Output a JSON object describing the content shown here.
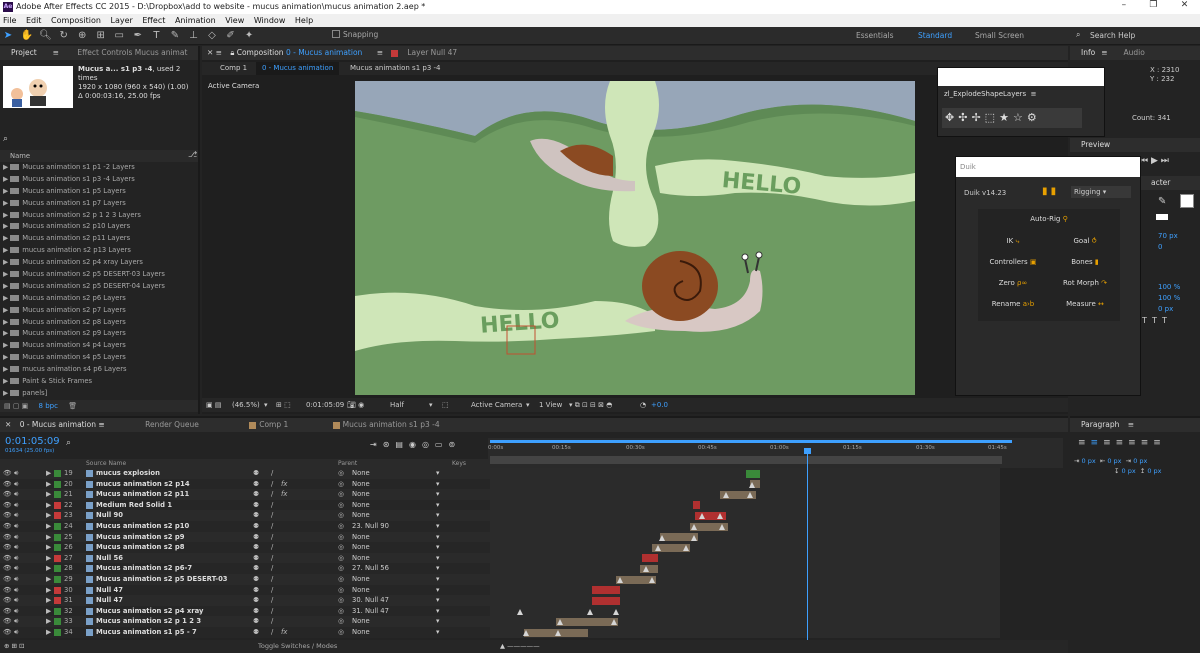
{
  "window": {
    "title": "Adobe After Effects CC 2015 - D:\\Dropbox\\add to website - mucus animation\\mucus animation 2.aep *",
    "controls": [
      "–",
      "❐",
      "✕"
    ]
  },
  "menu": [
    "File",
    "Edit",
    "Composition",
    "Layer",
    "Effect",
    "Animation",
    "View",
    "Window",
    "Help"
  ],
  "toolbar": {
    "snapping": "Snapping",
    "workspaces": [
      "Essentials",
      "Standard",
      "Small Screen"
    ],
    "active_workspace": "Standard",
    "search": "Search Help"
  },
  "project": {
    "tab": "Project",
    "effect_tab": "Effect Controls Mucus animat",
    "item_name": "Mucus a... s1 p3 -4",
    "used": ", used 2 times",
    "dims": "1920 x 1080  (960 x 540) (1.00)",
    "duration": "Δ 0:00:03:16, 25.00 fps",
    "col_name": "Name",
    "items": [
      "Mucus animation s1 p1 -2 Layers",
      "Mucus animation s1 p3 -4 Layers",
      "Mucus animation s1 p5 Layers",
      "Mucus animation s1 p7 Layers",
      "Mucus animation s2 p 1 2 3 Layers",
      "Mucus animation s2 p10 Layers",
      "Mucus animation s2 p11 Layers",
      "mucus animation s2 p13 Layers",
      "Mucus animation s2 p4 xray Layers",
      "Mucus animation s2 p5 DESERT-03 Layers",
      "Mucus animation s2 p5 DESERT-04 Layers",
      "Mucus animation s2 p6 Layers",
      "Mucus animation s2 p7 Layers",
      "Mucus animation s2 p8 Layers",
      "Mucus animation s2 p9 Layers",
      "Mucus animation s4 p4 Layers",
      "Mucus animation s4 p5 Layers",
      "mucus animation s4 p6 Layers",
      "Paint & Stick Frames",
      "panels]"
    ],
    "bpc": "8 bpc"
  },
  "comp": {
    "tab": "Composition",
    "tab_name": "0 - Mucus animation",
    "layer_tab": "Layer Null 47",
    "crumbs": [
      "Comp 1",
      "0 - Mucus animation",
      "Mucus animation s1 p3 -4"
    ],
    "active_camera": "Active Camera",
    "hello_top": "HELLO",
    "hello_bottom": "HELLO",
    "footer": {
      "zoom": "(46.5%)",
      "time": "0:01:05:09",
      "res": "Half",
      "camera": "Active Camera",
      "view": "1 View",
      "exposure": "+0.0"
    }
  },
  "explode": {
    "title": "zl_ExplodeShapeLayers"
  },
  "duik": {
    "title": "Duik",
    "version": "Duik v14.23",
    "mode": "Rigging",
    "buttons": [
      "Auto-Rig",
      "IK",
      "Goal",
      "Controllers",
      "Bones",
      "Zero",
      "Rot Morph",
      "Rename",
      "Measure"
    ]
  },
  "info": {
    "tab": "Info",
    "audio_tab": "Audio",
    "x": "X : 2310",
    "y": "Y : 232",
    "count": "Count: 341"
  },
  "preview": {
    "tab": "Preview"
  },
  "character": {
    "tab": "acter",
    "size": "70 px",
    "leading": "0",
    "scale_h": "100 %",
    "scale_v": "100 %",
    "zero": "0 px"
  },
  "paragraph": {
    "tab": "Paragraph",
    "vals": [
      "0 px",
      "0 px",
      "0 px",
      "0 px",
      "0 px"
    ]
  },
  "timeline": {
    "tabs": [
      "0 - Mucus animation",
      "Render Queue",
      "Comp 1",
      "Mucus animation s1 p3 -4"
    ],
    "timecode": "0:01:05:09",
    "frames": "01634 (25.00 fps)",
    "col_source": "Source Name",
    "col_parent": "Parent",
    "col_keys": "Keys",
    "ruler": [
      "0:00s",
      "00:15s",
      "00:30s",
      "00:45s",
      "01:00s",
      "01:15s",
      "01:30s",
      "01:45s"
    ],
    "toggle": "Toggle Switches / Modes",
    "layers": [
      {
        "n": "19",
        "name": "mucus explosion",
        "parent": "None",
        "color": "#3a8a3a",
        "fx": ""
      },
      {
        "n": "20",
        "name": "mucus animation s2 p14",
        "parent": "None",
        "color": "#3a8a3a",
        "fx": "fx"
      },
      {
        "n": "21",
        "name": "Mucus animation s2 p11",
        "parent": "None",
        "color": "#3a8a3a",
        "fx": "fx"
      },
      {
        "n": "22",
        "name": "Medium Red Solid 1",
        "parent": "None",
        "color": "#c53a3a",
        "fx": ""
      },
      {
        "n": "23",
        "name": "Null 90",
        "parent": "None",
        "color": "#c53a3a",
        "fx": ""
      },
      {
        "n": "24",
        "name": "Mucus animation s2 p10",
        "parent": "23. Null 90",
        "color": "#3a8a3a",
        "fx": ""
      },
      {
        "n": "25",
        "name": "Mucus animation s2 p9",
        "parent": "None",
        "color": "#3a8a3a",
        "fx": ""
      },
      {
        "n": "26",
        "name": "Mucus animation s2 p8",
        "parent": "None",
        "color": "#3a8a3a",
        "fx": ""
      },
      {
        "n": "27",
        "name": "Null 56",
        "parent": "None",
        "color": "#c53a3a",
        "fx": ""
      },
      {
        "n": "28",
        "name": "Mucus animation s2 p6-7",
        "parent": "27. Null 56",
        "color": "#3a8a3a",
        "fx": ""
      },
      {
        "n": "29",
        "name": "Mucus animation s2 p5 DESERT-03",
        "parent": "None",
        "color": "#3a8a3a",
        "fx": ""
      },
      {
        "n": "30",
        "name": "Null 47",
        "parent": "None",
        "color": "#c53a3a",
        "fx": ""
      },
      {
        "n": "31",
        "name": "Null 47",
        "parent": "30. Null 47",
        "color": "#c53a3a",
        "fx": ""
      },
      {
        "n": "32",
        "name": "Mucus animation s2 p4 xray",
        "parent": "31. Null 47",
        "color": "#3a8a3a",
        "fx": ""
      },
      {
        "n": "33",
        "name": "Mucus animation s2 p 1 2 3",
        "parent": "None",
        "color": "#3a8a3a",
        "fx": ""
      },
      {
        "n": "34",
        "name": "Mucus animation s1 p5 - 7",
        "parent": "None",
        "color": "#3a8a3a",
        "fx": "fx"
      }
    ]
  }
}
